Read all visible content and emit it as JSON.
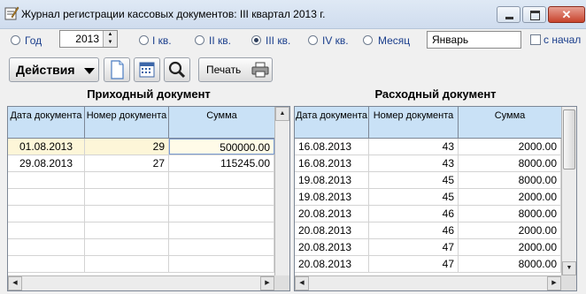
{
  "window": {
    "title": "Журнал регистрации кассовых документов: III квартал 2013 г.",
    "close_symbol": "✕"
  },
  "period": {
    "year_label": "Год",
    "year_value": "2013",
    "q1_label": "I кв.",
    "q2_label": "II кв.",
    "q3_label": "III кв.",
    "q4_label": "IV кв.",
    "month_label": "Месяц",
    "month_value": "Январь",
    "checkbox_label": "с начал",
    "selected": "III кв."
  },
  "toolbar": {
    "actions_label": "Действия",
    "print_label": "Печать",
    "icons": [
      "new-document-icon",
      "calendar-icon",
      "search-icon",
      "printer-icon"
    ]
  },
  "incoming": {
    "title": "Приходный документ",
    "headers": {
      "date": "Дата документа",
      "number": "Номер документа",
      "sum": "Сумма"
    },
    "rows": [
      {
        "date": "01.08.2013",
        "number": "29",
        "sum": "500000.00"
      },
      {
        "date": "29.08.2013",
        "number": "27",
        "sum": "115245.00"
      }
    ]
  },
  "outgoing": {
    "title": "Расходный документ",
    "headers": {
      "date": "Дата документа",
      "number": "Номер документа",
      "sum": "Сумма"
    },
    "rows": [
      {
        "date": "16.08.2013",
        "number": "43",
        "sum": "2000.00"
      },
      {
        "date": "16.08.2013",
        "number": "43",
        "sum": "8000.00"
      },
      {
        "date": "19.08.2013",
        "number": "45",
        "sum": "8000.00"
      },
      {
        "date": "19.08.2013",
        "number": "45",
        "sum": "2000.00"
      },
      {
        "date": "20.08.2013",
        "number": "46",
        "sum": "8000.00"
      },
      {
        "date": "20.08.2013",
        "number": "46",
        "sum": "2000.00"
      },
      {
        "date": "20.08.2013",
        "number": "47",
        "sum": "2000.00"
      },
      {
        "date": "20.08.2013",
        "number": "47",
        "sum": "8000.00"
      }
    ]
  },
  "colors": {
    "header_bg": "#c9e1f6",
    "selected_row": "#fdf6d8",
    "title_bar": "#dfe9f5",
    "label_text": "#1a3e8c"
  }
}
